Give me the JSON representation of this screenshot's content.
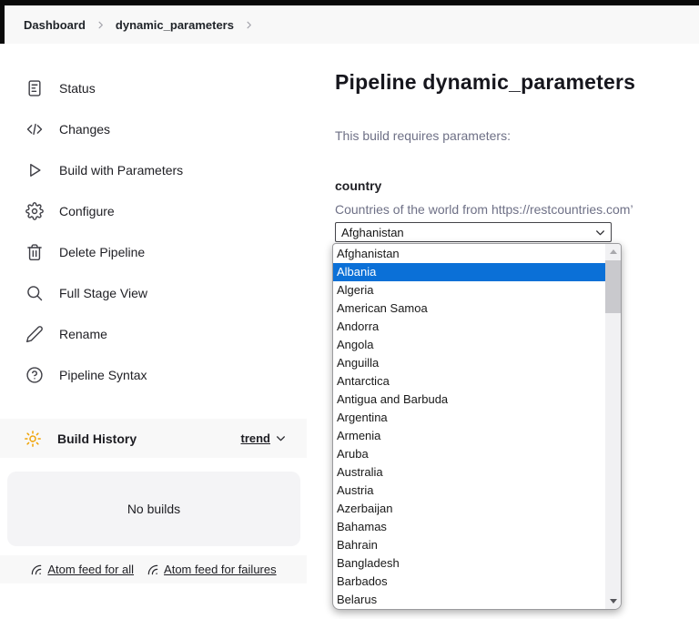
{
  "breadcrumb": {
    "items": [
      "Dashboard",
      "dynamic_parameters"
    ],
    "separator_icon": "chevron-right-icon"
  },
  "sidebar": {
    "items": [
      {
        "label": "Status",
        "icon": "document-icon"
      },
      {
        "label": "Changes",
        "icon": "code-icon"
      },
      {
        "label": "Build with Parameters",
        "icon": "play-icon"
      },
      {
        "label": "Configure",
        "icon": "gear-icon"
      },
      {
        "label": "Delete Pipeline",
        "icon": "trash-icon"
      },
      {
        "label": "Full Stage View",
        "icon": "search-icon"
      },
      {
        "label": "Rename",
        "icon": "pencil-icon"
      },
      {
        "label": "Pipeline Syntax",
        "icon": "question-icon"
      }
    ],
    "build_history": {
      "title": "Build History",
      "icon": "weather-sun-icon",
      "trend_label": "trend",
      "trend_icon": "chevron-down-icon",
      "empty_text": "No builds",
      "feed_all": "Atom feed for all",
      "feed_failures": "Atom feed for failures",
      "feed_icon": "rss-icon"
    }
  },
  "main": {
    "title": "Pipeline dynamic_parameters",
    "subtitle": "This build requires parameters:",
    "parameter": {
      "name": "country",
      "description": "Countries of the world from https://restcountries.com’",
      "selected": "Afghanistan",
      "highlighted": "Albania",
      "options": [
        "Afghanistan",
        "Albania",
        "Algeria",
        "American Samoa",
        "Andorra",
        "Angola",
        "Anguilla",
        "Antarctica",
        "Antigua and Barbuda",
        "Argentina",
        "Armenia",
        "Aruba",
        "Australia",
        "Austria",
        "Azerbaijan",
        "Bahamas",
        "Bahrain",
        "Bangladesh",
        "Barbados",
        "Belarus"
      ]
    }
  },
  "colors": {
    "option_highlight": "#0b70d7",
    "build_history_icon": "#f0a202",
    "topbar": "#0a0a0a",
    "panel_bg": "#f8f8f8"
  }
}
